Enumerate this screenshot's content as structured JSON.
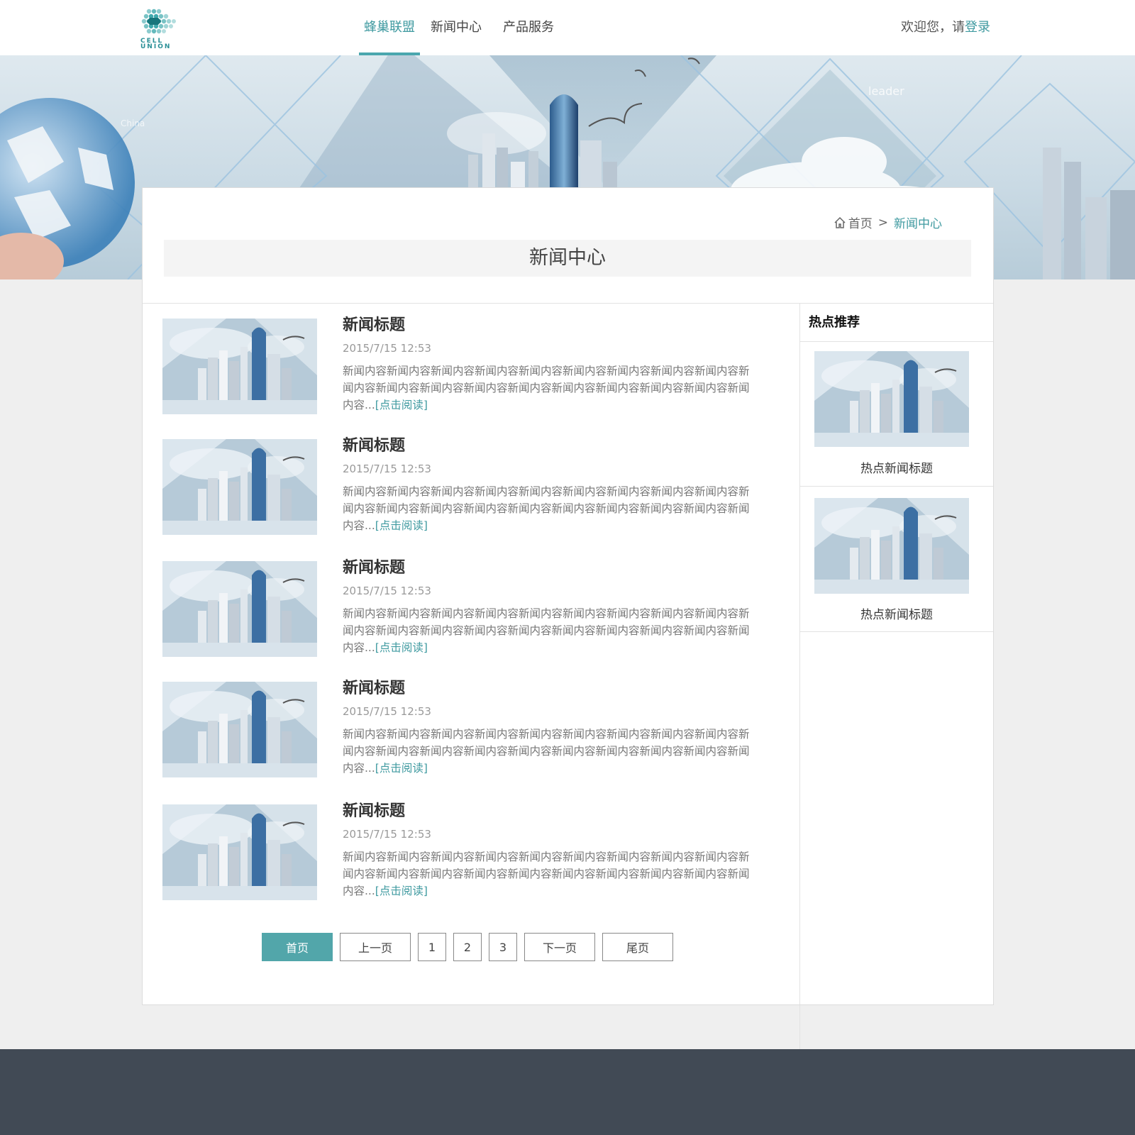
{
  "header": {
    "logo_text_line1": "CELL",
    "logo_text_line2": "UNION",
    "nav": [
      {
        "label": "蜂巢联盟"
      },
      {
        "label": "新闻中心"
      },
      {
        "label": "产品服务"
      }
    ],
    "welcome_prefix": "欢迎您，请",
    "login_label": "登录"
  },
  "breadcrumb": {
    "home": "首页",
    "separator": ">",
    "current": "新闻中心"
  },
  "page_title": "新闻中心",
  "news": [
    {
      "title": "新闻标题",
      "date": "2015/7/15 12:53",
      "content": "新闻内容新闻内容新闻内容新闻内容新闻内容新闻内容新闻内容新闻内容新闻内容新闻内容新闻内容新闻内容新闻内容新闻内容新闻内容新闻内容新闻内容新闻内容新闻内容...",
      "read_more": "[点击阅读]"
    },
    {
      "title": "新闻标题",
      "date": "2015/7/15 12:53",
      "content": "新闻内容新闻内容新闻内容新闻内容新闻内容新闻内容新闻内容新闻内容新闻内容新闻内容新闻内容新闻内容新闻内容新闻内容新闻内容新闻内容新闻内容新闻内容新闻内容...",
      "read_more": "[点击阅读]"
    },
    {
      "title": "新闻标题",
      "date": "2015/7/15 12:53",
      "content": "新闻内容新闻内容新闻内容新闻内容新闻内容新闻内容新闻内容新闻内容新闻内容新闻内容新闻内容新闻内容新闻内容新闻内容新闻内容新闻内容新闻内容新闻内容新闻内容...",
      "read_more": "[点击阅读]"
    },
    {
      "title": "新闻标题",
      "date": "2015/7/15 12:53",
      "content": "新闻内容新闻内容新闻内容新闻内容新闻内容新闻内容新闻内容新闻内容新闻内容新闻内容新闻内容新闻内容新闻内容新闻内容新闻内容新闻内容新闻内容新闻内容新闻内容...",
      "read_more": "[点击阅读]"
    },
    {
      "title": "新闻标题",
      "date": "2015/7/15 12:53",
      "content": "新闻内容新闻内容新闻内容新闻内容新闻内容新闻内容新闻内容新闻内容新闻内容新闻内容新闻内容新闻内容新闻内容新闻内容新闻内容新闻内容新闻内容新闻内容新闻内容...",
      "read_more": "[点击阅读]"
    }
  ],
  "sidebar": {
    "title": "热点推荐",
    "items": [
      {
        "title": "热点新闻标题"
      },
      {
        "title": "热点新闻标题"
      }
    ]
  },
  "banner_text": {
    "leader": "leader",
    "china": "China"
  },
  "pagination": {
    "first": "首页",
    "prev": "上一页",
    "pages": [
      "1",
      "2",
      "3"
    ],
    "next": "下一页",
    "last": "尾页"
  },
  "colors": {
    "accent": "#3f9aa0",
    "accent_button": "#52a6aa",
    "footer": "#414a55",
    "page_bg": "#efefef"
  }
}
